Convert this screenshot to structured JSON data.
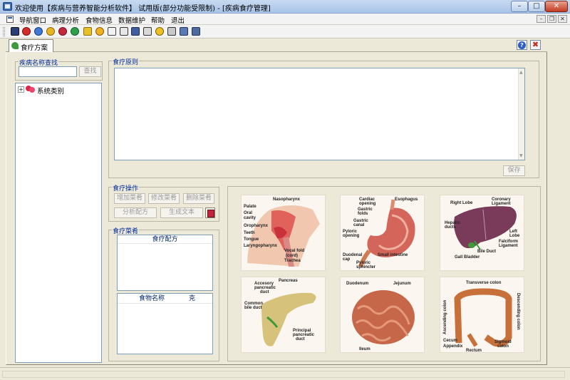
{
  "window": {
    "title": "欢迎使用【疾病与营养智能分析软件】 试用版(部分功能受限制) - [疾病食疗管理]",
    "min_glyph": "–",
    "max_glyph": "□",
    "close_glyph": "✕"
  },
  "menu": {
    "items": [
      "导航窗口",
      "病理分析",
      "食物信息",
      "数据维护",
      "帮助",
      "退出"
    ],
    "mdi_min": "–",
    "mdi_restore": "❐",
    "mdi_close": "✕"
  },
  "toolbar": {
    "icons": [
      "save-icon",
      "stop-icon",
      "patient-icon",
      "pills-icon",
      "chart-icon",
      "group-icon",
      "key-icon",
      "apple-icon",
      "search-doc-icon",
      "calendar-icon",
      "image-icon",
      "monitor-icon",
      "help-icon",
      "print-icon",
      "settings-icon",
      "exit-icon"
    ]
  },
  "tab": {
    "label": "食疗方案",
    "help": "?",
    "close": "✖"
  },
  "search": {
    "group_label": "疾病名称查找",
    "input_value": "",
    "button": "查找"
  },
  "tree": {
    "expander": "+",
    "root_label": "系统类别"
  },
  "principle": {
    "group_label": "食疗原则",
    "content": "",
    "save_button": "保存",
    "scroll_up": "▲",
    "scroll_down": "▼"
  },
  "operations": {
    "group_label": "食疗操作",
    "add_dish": "增加菜肴",
    "edit_dish": "修改菜肴",
    "delete_dish": "删除菜肴",
    "analyze_recipe": "分析配方",
    "generate_text": "生成文本"
  },
  "dishes": {
    "group_label": "食疗菜肴",
    "recipe_header": "食疗配方",
    "food_col_name": "食物名称",
    "food_col_grams": "克"
  },
  "images": {
    "mouth": [
      "Nasopharynx",
      "Palate",
      "Oral",
      "cavity",
      "Oropharynx",
      "Teeth",
      "Tongue",
      "Laryngopharynx",
      "Vocal fold",
      "(cord)",
      "Trachea"
    ],
    "stomach": [
      "Cardiac",
      "opening",
      "Esophagus",
      "Gastric",
      "folds",
      "Gastric",
      "canal",
      "Pyloric",
      "opening",
      "Duodenal",
      "cap",
      "Pyloric",
      "sphincter",
      "Small intestine"
    ],
    "liver": [
      "Coronary",
      "Ligament",
      "Right Lobe",
      "Hepatic",
      "ducts",
      "Left",
      "Lobe",
      "Falciform",
      "Ligament",
      "Bile Duct",
      "Gall Bladder"
    ],
    "pancreas": [
      "Accesory",
      "pancreatic",
      "duct",
      "Pancreas",
      "Common",
      "bile duct",
      "Principal",
      "pancreatic",
      "duct"
    ],
    "intestine": [
      "Duodenum",
      "Jejunum",
      "Ileum"
    ],
    "colon": [
      "Transverse colon",
      "Ascending colon",
      "Descending colon",
      "Cecum",
      "Appendix",
      "Rectum",
      "Sigmoid",
      "colon"
    ]
  }
}
